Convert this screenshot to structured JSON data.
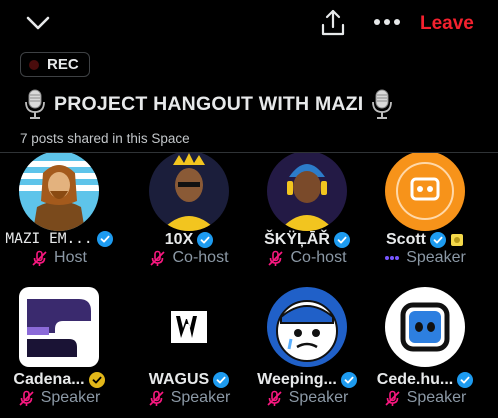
{
  "topbar": {
    "leave_label": "Leave",
    "leave_color": "#f4212e"
  },
  "rec_label": "REC",
  "space": {
    "title": "PROJECT HANGOUT WITH MAZI",
    "posts_shared": "7 posts shared in this Space"
  },
  "participants": [
    {
      "name": "MAZI EM...",
      "role": "Host",
      "verified": "blue",
      "mic": "muted"
    },
    {
      "name": "10X",
      "role": "Co-host",
      "verified": "blue",
      "mic": "muted"
    },
    {
      "name": "ŠKŸĻĀŘ",
      "role": "Co-host",
      "verified": "blue",
      "mic": "muted"
    },
    {
      "name": "Scott",
      "role": "Speaker",
      "verified": "blue",
      "mic": "speaking"
    },
    {
      "name": "Cadena...",
      "role": "Speaker",
      "verified": "gold",
      "mic": "muted"
    },
    {
      "name": "WAGUS",
      "role": "Speaker",
      "verified": "blue",
      "mic": "muted"
    },
    {
      "name": "Weeping...",
      "role": "Speaker",
      "verified": "blue",
      "mic": "muted"
    },
    {
      "name": "Cede.hu...",
      "role": "Speaker",
      "verified": "blue",
      "mic": "muted"
    }
  ],
  "colors": {
    "background": "#000000",
    "verified_blue": "#1d9bf0",
    "verified_gold": "#e2b719",
    "mute_pink": "#f91880",
    "speaking_purple": "#7856ff"
  }
}
